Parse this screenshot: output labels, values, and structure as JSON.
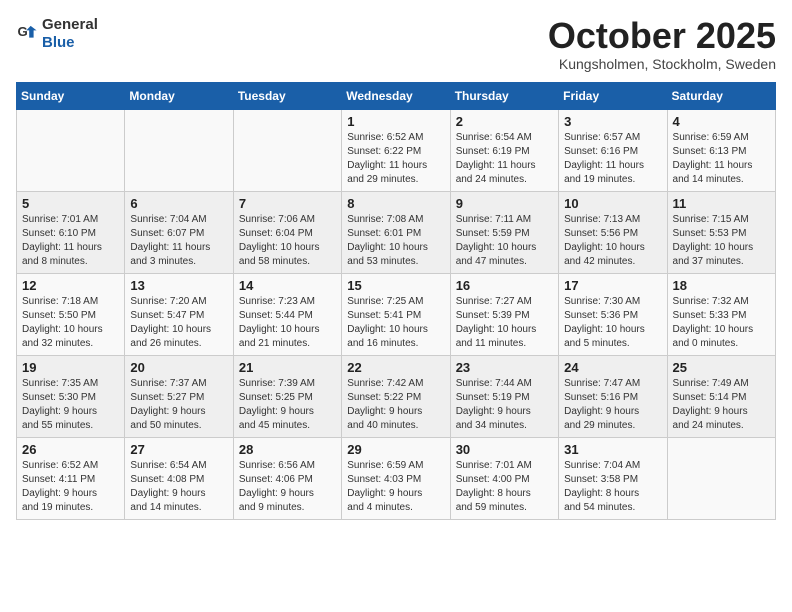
{
  "header": {
    "logo": {
      "text_general": "General",
      "text_blue": "Blue"
    },
    "month": "October 2025",
    "location": "Kungsholmen, Stockholm, Sweden"
  },
  "days_of_week": [
    "Sunday",
    "Monday",
    "Tuesday",
    "Wednesday",
    "Thursday",
    "Friday",
    "Saturday"
  ],
  "weeks": [
    [
      {
        "day": "",
        "info": ""
      },
      {
        "day": "",
        "info": ""
      },
      {
        "day": "",
        "info": ""
      },
      {
        "day": "1",
        "info": "Sunrise: 6:52 AM\nSunset: 6:22 PM\nDaylight: 11 hours\nand 29 minutes."
      },
      {
        "day": "2",
        "info": "Sunrise: 6:54 AM\nSunset: 6:19 PM\nDaylight: 11 hours\nand 24 minutes."
      },
      {
        "day": "3",
        "info": "Sunrise: 6:57 AM\nSunset: 6:16 PM\nDaylight: 11 hours\nand 19 minutes."
      },
      {
        "day": "4",
        "info": "Sunrise: 6:59 AM\nSunset: 6:13 PM\nDaylight: 11 hours\nand 14 minutes."
      }
    ],
    [
      {
        "day": "5",
        "info": "Sunrise: 7:01 AM\nSunset: 6:10 PM\nDaylight: 11 hours\nand 8 minutes."
      },
      {
        "day": "6",
        "info": "Sunrise: 7:04 AM\nSunset: 6:07 PM\nDaylight: 11 hours\nand 3 minutes."
      },
      {
        "day": "7",
        "info": "Sunrise: 7:06 AM\nSunset: 6:04 PM\nDaylight: 10 hours\nand 58 minutes."
      },
      {
        "day": "8",
        "info": "Sunrise: 7:08 AM\nSunset: 6:01 PM\nDaylight: 10 hours\nand 53 minutes."
      },
      {
        "day": "9",
        "info": "Sunrise: 7:11 AM\nSunset: 5:59 PM\nDaylight: 10 hours\nand 47 minutes."
      },
      {
        "day": "10",
        "info": "Sunrise: 7:13 AM\nSunset: 5:56 PM\nDaylight: 10 hours\nand 42 minutes."
      },
      {
        "day": "11",
        "info": "Sunrise: 7:15 AM\nSunset: 5:53 PM\nDaylight: 10 hours\nand 37 minutes."
      }
    ],
    [
      {
        "day": "12",
        "info": "Sunrise: 7:18 AM\nSunset: 5:50 PM\nDaylight: 10 hours\nand 32 minutes."
      },
      {
        "day": "13",
        "info": "Sunrise: 7:20 AM\nSunset: 5:47 PM\nDaylight: 10 hours\nand 26 minutes."
      },
      {
        "day": "14",
        "info": "Sunrise: 7:23 AM\nSunset: 5:44 PM\nDaylight: 10 hours\nand 21 minutes."
      },
      {
        "day": "15",
        "info": "Sunrise: 7:25 AM\nSunset: 5:41 PM\nDaylight: 10 hours\nand 16 minutes."
      },
      {
        "day": "16",
        "info": "Sunrise: 7:27 AM\nSunset: 5:39 PM\nDaylight: 10 hours\nand 11 minutes."
      },
      {
        "day": "17",
        "info": "Sunrise: 7:30 AM\nSunset: 5:36 PM\nDaylight: 10 hours\nand 5 minutes."
      },
      {
        "day": "18",
        "info": "Sunrise: 7:32 AM\nSunset: 5:33 PM\nDaylight: 10 hours\nand 0 minutes."
      }
    ],
    [
      {
        "day": "19",
        "info": "Sunrise: 7:35 AM\nSunset: 5:30 PM\nDaylight: 9 hours\nand 55 minutes."
      },
      {
        "day": "20",
        "info": "Sunrise: 7:37 AM\nSunset: 5:27 PM\nDaylight: 9 hours\nand 50 minutes."
      },
      {
        "day": "21",
        "info": "Sunrise: 7:39 AM\nSunset: 5:25 PM\nDaylight: 9 hours\nand 45 minutes."
      },
      {
        "day": "22",
        "info": "Sunrise: 7:42 AM\nSunset: 5:22 PM\nDaylight: 9 hours\nand 40 minutes."
      },
      {
        "day": "23",
        "info": "Sunrise: 7:44 AM\nSunset: 5:19 PM\nDaylight: 9 hours\nand 34 minutes."
      },
      {
        "day": "24",
        "info": "Sunrise: 7:47 AM\nSunset: 5:16 PM\nDaylight: 9 hours\nand 29 minutes."
      },
      {
        "day": "25",
        "info": "Sunrise: 7:49 AM\nSunset: 5:14 PM\nDaylight: 9 hours\nand 24 minutes."
      }
    ],
    [
      {
        "day": "26",
        "info": "Sunrise: 6:52 AM\nSunset: 4:11 PM\nDaylight: 9 hours\nand 19 minutes."
      },
      {
        "day": "27",
        "info": "Sunrise: 6:54 AM\nSunset: 4:08 PM\nDaylight: 9 hours\nand 14 minutes."
      },
      {
        "day": "28",
        "info": "Sunrise: 6:56 AM\nSunset: 4:06 PM\nDaylight: 9 hours\nand 9 minutes."
      },
      {
        "day": "29",
        "info": "Sunrise: 6:59 AM\nSunset: 4:03 PM\nDaylight: 9 hours\nand 4 minutes."
      },
      {
        "day": "30",
        "info": "Sunrise: 7:01 AM\nSunset: 4:00 PM\nDaylight: 8 hours\nand 59 minutes."
      },
      {
        "day": "31",
        "info": "Sunrise: 7:04 AM\nSunset: 3:58 PM\nDaylight: 8 hours\nand 54 minutes."
      },
      {
        "day": "",
        "info": ""
      }
    ]
  ]
}
